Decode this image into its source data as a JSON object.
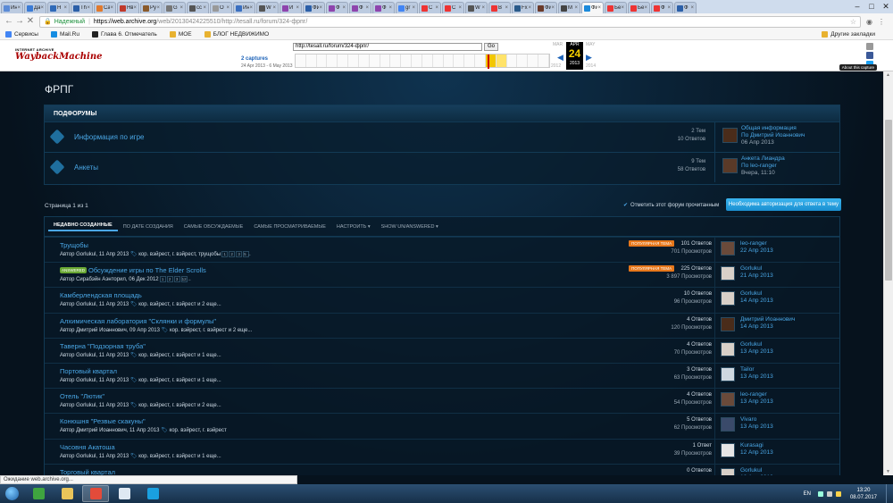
{
  "browser": {
    "tabs": [
      {
        "label": "Ин",
        "color": "#5b8bd6"
      },
      {
        "label": "Да",
        "color": "#3a7bd5"
      },
      {
        "label": "H",
        "color": "#2f6ab8"
      },
      {
        "label": "Th",
        "color": "#2b5fa8"
      },
      {
        "label": "Са",
        "color": "#e07a2e"
      },
      {
        "label": "Нв",
        "color": "#c0392b"
      },
      {
        "label": "Ру",
        "color": "#8a5a2b"
      },
      {
        "label": "G",
        "color": "#777"
      },
      {
        "label": "cc",
        "color": "#555"
      },
      {
        "label": "О",
        "color": "#999"
      },
      {
        "label": "Ин",
        "color": "#3a6fc0"
      },
      {
        "label": "W",
        "color": "#555"
      },
      {
        "label": "И",
        "color": "#8e44ad"
      },
      {
        "label": "ФИ",
        "color": "#2b5fa8"
      },
      {
        "label": "Ф",
        "color": "#8e44ad"
      },
      {
        "label": "Ф",
        "color": "#8e44ad"
      },
      {
        "label": "Ф",
        "color": "#8e44ad"
      },
      {
        "label": "gr",
        "color": "#4285f4"
      },
      {
        "label": "С",
        "color": "#e33"
      },
      {
        "label": "С",
        "color": "#e33"
      },
      {
        "label": "W",
        "color": "#555"
      },
      {
        "label": "В",
        "color": "#e33"
      },
      {
        "label": "Fx",
        "color": "#2a5a8a"
      },
      {
        "label": "Фи",
        "color": "#6a3a2a"
      },
      {
        "label": "М",
        "color": "#444"
      },
      {
        "label": "Фи",
        "color": "#1c8adb",
        "active": true
      },
      {
        "label": "Бе",
        "color": "#e33"
      },
      {
        "label": "Бе",
        "color": "#e33"
      },
      {
        "label": "Ф",
        "color": "#e33"
      },
      {
        "label": "Ф",
        "color": "#2b5fa8"
      }
    ],
    "secure_label": "Надежный",
    "url_host": "https://web.archive.org",
    "url_rest": "/web/20130424225510/http://tesall.ru/forum/324-фрпг/",
    "bookmarks": [
      {
        "label": "Сервисы",
        "color": "#4285f4"
      },
      {
        "label": "Mail.Ru",
        "color": "#168de2"
      },
      {
        "label": "Глава 6. Отмечатель",
        "color": "#222"
      },
      {
        "label": "МОЕ",
        "color": "#e8b230"
      },
      {
        "label": "БЛОГ НЕДВИЖИМО",
        "color": "#e8b230"
      }
    ],
    "other_bookmarks": "Другие закладки"
  },
  "wayback": {
    "logo_top": "INTERNET ARCHIVE",
    "logo_main": "WaybackMachine",
    "url": "http://tesall.ru/forum/324-фрпг/",
    "go": "Go",
    "captures": "2 captures",
    "capture_dates": "24 Apr 2013 - 6 May 2013",
    "prev_month": "MAR",
    "cur_month": "APR",
    "next_month": "MAY",
    "day": "24",
    "year": "2013",
    "prev_year": "2012",
    "next_year": "2014",
    "about": "About this capture"
  },
  "forum": {
    "title": "ФРПГ",
    "subforums_header": "ПОДФОРУМЫ",
    "subforums": [
      {
        "title": "Информация по игре",
        "topics": "2 Тем",
        "replies": "10 Ответов",
        "last_title": "Общая информация",
        "last_by": "По Дмитрий Иоаннович",
        "last_date": "06 Апр 2013",
        "avatar": "#4a2c1a"
      },
      {
        "title": "Анкеты",
        "topics": "9 Тем",
        "replies": "58 Ответов",
        "last_title": "Анкета Лиандра",
        "last_by": "По leo-ranger",
        "last_date": "Вчера, 11:10",
        "avatar": "#5a3a28"
      }
    ],
    "page_info": "Страница 1 из 1",
    "mark_read": "Отметить этот форум прочитанным",
    "auth_button": "Необходима авторизация для ответа в тему",
    "filters": [
      {
        "label": "НЕДАВНО СОЗДАННЫЕ",
        "active": true
      },
      {
        "label": "ПО ДАТЕ СОЗДАНИЯ"
      },
      {
        "label": "САМЫЕ ОБСУЖДАЕМЫЕ"
      },
      {
        "label": "САМЫЕ ПРОСМАТРИВАЕМЫЕ"
      },
      {
        "label": "НАСТРОИТЬ ▾"
      },
      {
        "label": "SHOW UN/ANSWERED ▾"
      }
    ],
    "popular_label": "ПОПУЛЯРНАЯ ТЕМА",
    "answered_label": "ANSWERED",
    "topics": [
      {
        "title": "Трущобы",
        "meta": "Автор Gorlukul, 11 Апр 2013",
        "tags": "кор. вэйрест, г. вэйрест, трущобы",
        "pages": [
          "1",
          "2",
          "3",
          "5 →"
        ],
        "popular": true,
        "replies": "101 Ответов",
        "views": "701 Просмотров",
        "last_user": "leo-ranger",
        "last_date": "22 Апр 2013",
        "avatar": "#6a4a3a"
      },
      {
        "title": "Обсуждение игры по The Elder Scrolls",
        "meta": "Автор Сирабэйн Аэнторил, 06 Дек 2012",
        "tags": "",
        "pages": [
          "1",
          "2",
          "3",
          "12 →"
        ],
        "popular": true,
        "answered": true,
        "replies": "225 Ответов",
        "views": "3 897 Просмотров",
        "last_user": "Gorlukul",
        "last_date": "21 Апр 2013",
        "avatar": "#d8d0c8"
      },
      {
        "title": "Камберлендская площадь",
        "meta": "Автор Gorlukul, 11 Апр 2013",
        "tags": "кор. вэйрест, г. вэйрест и 2 еще...",
        "pages": [],
        "replies": "10 Ответов",
        "views": "96 Просмотров",
        "last_user": "Gorlukul",
        "last_date": "14 Апр 2013",
        "avatar": "#d8d0c8"
      },
      {
        "title": "Алхимическая лаборатория \"Склянки и формулы\"",
        "meta": "Автор Дмитрий Иоаннович, 09 Апр 2013",
        "tags": "кор. вэйрест, г. вэйрест и 2 еще...",
        "pages": [],
        "replies": "4 Ответов",
        "views": "120 Просмотров",
        "last_user": "Дмитрий Иоаннович",
        "last_date": "14 Апр 2013",
        "avatar": "#4a2c1a"
      },
      {
        "title": "Таверна \"Подзорная труба\"",
        "meta": "Автор Gorlukul, 11 Апр 2013",
        "tags": "кор. вэйрест, г. вэйрест и 1 еще...",
        "pages": [],
        "replies": "4 Ответов",
        "views": "70 Просмотров",
        "last_user": "Gorlukul",
        "last_date": "13 Апр 2013",
        "avatar": "#d8d0c8"
      },
      {
        "title": "Портовый квартал",
        "meta": "Автор Gorlukul, 11 Апр 2013",
        "tags": "кор. вэйрест, г. вэйрест и 1 еще...",
        "pages": [],
        "replies": "3 Ответов",
        "views": "63 Просмотров",
        "last_user": "Tailor",
        "last_date": "13 Апр 2013",
        "avatar": "#cfd8e0"
      },
      {
        "title": "Отель \"Лютик\"",
        "meta": "Автор Gorlukul, 11 Апр 2013",
        "tags": "кор. вэйрест, г. вэйрест и 2 еще...",
        "pages": [],
        "replies": "4 Ответов",
        "views": "54 Просмотров",
        "last_user": "leo-ranger",
        "last_date": "13 Апр 2013",
        "avatar": "#6a4a3a"
      },
      {
        "title": "Конюшня \"Резвые скакуны\"",
        "meta": "Автор Дмитрий Иоаннович, 11 Апр 2013",
        "tags": "кор. вэйрест, г. вэйрест",
        "pages": [],
        "replies": "5 Ответов",
        "views": "62 Просмотров",
        "last_user": "Vivaro",
        "last_date": "13 Апр 2013",
        "avatar": "#3a4a6a"
      },
      {
        "title": "Часовня Акатоша",
        "meta": "Автор Gorlukul, 11 Апр 2013",
        "tags": "кор. вэйрест, г. вэйрест и 1 еще...",
        "pages": [],
        "replies": "1 Ответ",
        "views": "39 Просмотров",
        "last_user": "Kurasagi",
        "last_date": "12 Апр 2013",
        "avatar": "#e6e6e6"
      },
      {
        "title": "Торговый квартал",
        "meta": "",
        "tags": "",
        "pages": [],
        "replies": "0 Ответов",
        "views": "19 Просмотров",
        "last_user": "Gorlukul",
        "last_date": "12 Апр 2013",
        "avatar": "#d8d0c8"
      }
    ]
  },
  "statusbar": "Ожидание web.archive.org...",
  "taskbar": {
    "apps": [
      {
        "name": "utorrent",
        "color": "#3fa43f"
      },
      {
        "name": "explorer",
        "color": "#e8c45a"
      },
      {
        "name": "chrome",
        "color": "#e34b3a",
        "active": true
      },
      {
        "name": "notepad",
        "color": "#dfe8f2"
      },
      {
        "name": "skype",
        "color": "#1aa0e0"
      }
    ],
    "lang": "EN",
    "time": "13:20",
    "date": "08.07.2017"
  }
}
